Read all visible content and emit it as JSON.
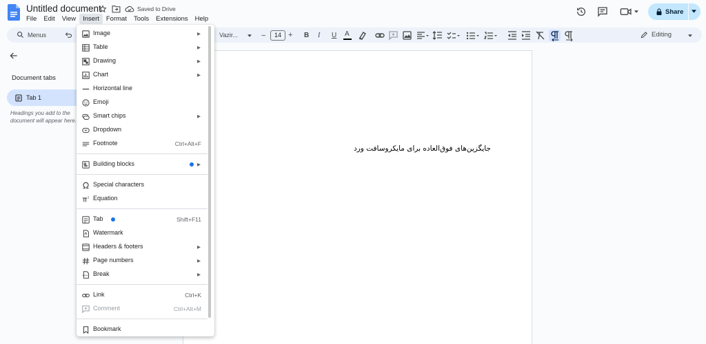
{
  "title_bar": {
    "doc_title": "Untitled document",
    "saved_status": "Saved to Drive",
    "share_label": "Share"
  },
  "menu_bar": {
    "items": [
      "File",
      "Edit",
      "View",
      "Insert",
      "Format",
      "Tools",
      "Extensions",
      "Help"
    ],
    "active": "Insert"
  },
  "toolbar": {
    "menus_label": "Menus",
    "font_name": "Vazir...",
    "font_size": "14",
    "bold": "B",
    "italic": "I",
    "underline": "U",
    "text_color": "A",
    "editing_mode": "Editing",
    "minus": "−",
    "plus": "+"
  },
  "sidebar": {
    "title": "Document tabs",
    "tab_label": "Tab 1",
    "hint": "Headings you add to the document will appear here."
  },
  "document": {
    "text": "جایگزین‌های فوق‌العاده برای مایکروسافت ورد"
  },
  "insert_menu": {
    "items": [
      {
        "label": "Image",
        "icon": "image-icon",
        "submenu": true
      },
      {
        "label": "Table",
        "icon": "table-icon",
        "submenu": true
      },
      {
        "label": "Drawing",
        "icon": "drawing-icon",
        "submenu": true
      },
      {
        "label": "Chart",
        "icon": "chart-icon",
        "submenu": true
      },
      {
        "label": "Horizontal line",
        "icon": "horizontal-line-icon"
      },
      {
        "label": "Emoji",
        "icon": "emoji-icon"
      },
      {
        "label": "Smart chips",
        "icon": "smart-chips-icon",
        "submenu": true
      },
      {
        "label": "Dropdown",
        "icon": "dropdown-icon"
      },
      {
        "label": "Footnote",
        "icon": "footnote-icon",
        "shortcut": "Ctrl+Alt+F"
      },
      {
        "label": "Building blocks",
        "icon": "building-blocks-icon",
        "submenu": true,
        "new_dot": true
      },
      {
        "label": "Special characters",
        "icon": "omega-icon"
      },
      {
        "label": "Equation",
        "icon": "pi-icon"
      },
      {
        "label": "Tab",
        "icon": "tab-icon",
        "shortcut": "Shift+F11",
        "new_dot": true
      },
      {
        "label": "Watermark",
        "icon": "watermark-icon"
      },
      {
        "label": "Headers & footers",
        "icon": "headers-footers-icon",
        "submenu": true
      },
      {
        "label": "Page numbers",
        "icon": "page-numbers-icon",
        "submenu": true
      },
      {
        "label": "Break",
        "icon": "break-icon",
        "submenu": true
      },
      {
        "label": "Link",
        "icon": "link-icon",
        "shortcut": "Ctrl+K"
      },
      {
        "label": "Comment",
        "icon": "comment-icon",
        "shortcut": "Ctrl+Alt+M",
        "disabled": true
      },
      {
        "label": "Bookmark",
        "icon": "bookmark-icon"
      }
    ]
  },
  "colors": {
    "accent": "#1a73e8",
    "share_bg": "#c2e7ff",
    "tab_active_bg": "#d3e3fd",
    "toolbar_bg": "#edf2fa"
  }
}
